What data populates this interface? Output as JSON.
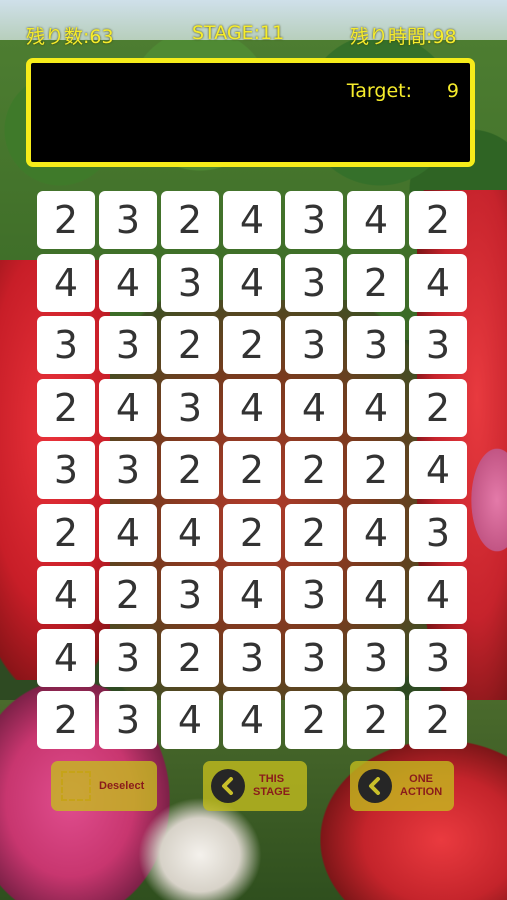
{
  "hud": {
    "remaining": "残り数:63",
    "stage": "STAGE:11",
    "time": "残り時間:98"
  },
  "target": {
    "label": "Target:",
    "value": "9"
  },
  "board": {
    "rows": [
      [
        2,
        3,
        2,
        4,
        3,
        4,
        2
      ],
      [
        4,
        4,
        3,
        4,
        3,
        2,
        4
      ],
      [
        3,
        3,
        2,
        2,
        3,
        3,
        3
      ],
      [
        2,
        4,
        3,
        4,
        4,
        4,
        2
      ],
      [
        3,
        3,
        2,
        2,
        2,
        2,
        4
      ],
      [
        2,
        4,
        4,
        2,
        2,
        4,
        3
      ],
      [
        4,
        2,
        3,
        4,
        3,
        4,
        4
      ],
      [
        4,
        3,
        2,
        3,
        3,
        3,
        3
      ],
      [
        2,
        3,
        4,
        4,
        2,
        2,
        2
      ]
    ]
  },
  "buttons": {
    "deselect": {
      "label": "Deselect",
      "icon": "selection-square-icon"
    },
    "this_stage": {
      "label_line1": "THIS",
      "label_line2": "STAGE",
      "icon": "back-arrow-icon"
    },
    "one_action": {
      "label_line1": "ONE",
      "label_line2": "ACTION",
      "icon": "back-arrow-icon"
    }
  },
  "colors": {
    "hud_text": "#f6ec2c",
    "panel_border": "#f6ec1a",
    "button_fill": "#c4be1e",
    "button_text": "#8a1b1b"
  }
}
